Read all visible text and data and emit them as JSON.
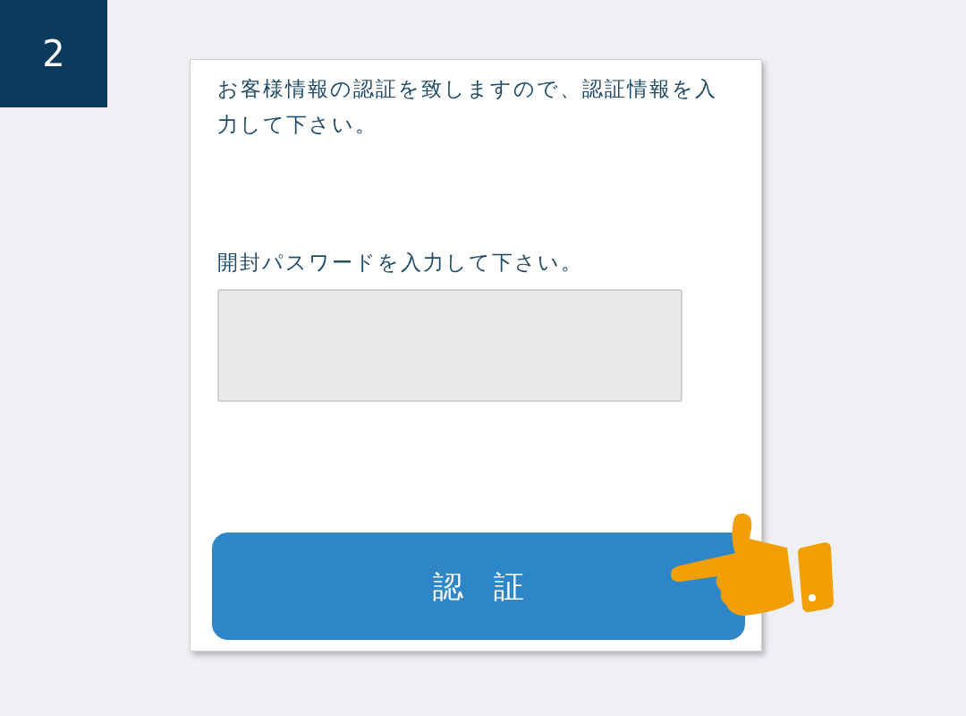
{
  "step_badge": "2",
  "instruction": "お客様情報の認証を致しますので、認証情報を入力して下さい。",
  "password_label": "開封パスワードを入力して下さい。",
  "submit_button": "認　証"
}
